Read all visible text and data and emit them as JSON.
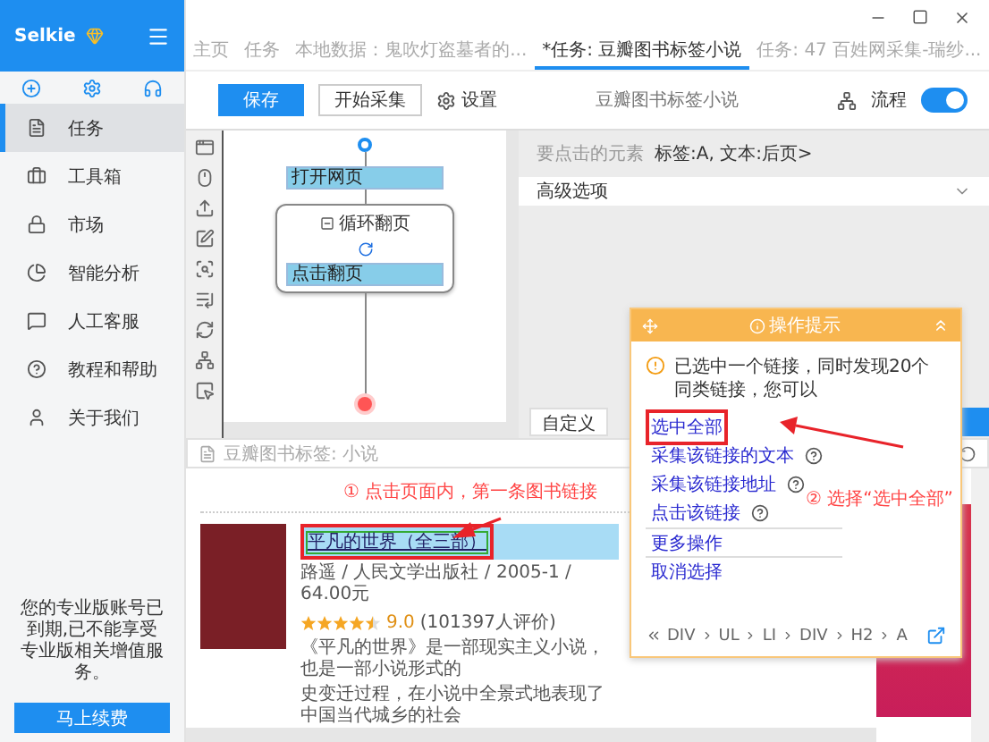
{
  "app": {
    "name": "Selkie"
  },
  "sidebar": {
    "items": [
      {
        "label": "任务",
        "selected": true
      },
      {
        "label": "工具箱",
        "selected": false
      },
      {
        "label": "市场",
        "selected": false
      },
      {
        "label": "智能分析",
        "selected": false
      },
      {
        "label": "人工客服",
        "selected": false
      },
      {
        "label": "教程和帮助",
        "selected": false
      },
      {
        "label": "关于我们",
        "selected": false
      }
    ],
    "notice": "您的专业版账号已到期,已不能享受专业版相关增值服务。",
    "renew_button": "马上续费"
  },
  "tabs": [
    {
      "label": "主页",
      "selected": false
    },
    {
      "label": "任务",
      "selected": false
    },
    {
      "label": "本地数据：鬼吹灯盗墓者的...",
      "selected": false
    },
    {
      "label": "*任务: 豆瓣图书标签小说",
      "selected": true
    },
    {
      "label": "任务: 47 百姓网采集-瑞纱...",
      "selected": false
    }
  ],
  "toolbar": {
    "save": "保存",
    "start": "开始采集",
    "settings": "设置",
    "title": "豆瓣图书标签小说",
    "flow_label": "流程",
    "flow_on": true
  },
  "flow": {
    "open_page": "打开网页",
    "loop": "循环翻页",
    "click_page": "点击翻页"
  },
  "settings_panel": {
    "element_label": "要点击的元素",
    "element_value": "标签:A, 文本:后页>",
    "advanced": "高级选项",
    "custom_button": "自定义"
  },
  "url_bar": {
    "text": "豆瓣图书标签: 小说"
  },
  "page": {
    "instruction": "① 点击页面内，第一条图书链接",
    "book": {
      "title": "平凡的世界（全三部）",
      "meta": "路遥 / 人民文学出版社 / 2005-1 / 64.00元",
      "stars": 4.5,
      "rating": "9.0",
      "votes": "(101397人评价)",
      "description": [
        "《平凡的世界》是一部现实主义小说，也是一部小说形式的",
        "史变迁过程，在小说中全景式地表现了中国当代城乡的社会"
      ]
    }
  },
  "popup": {
    "title": "操作提示",
    "message": "已选中一个链接，同时发现20个同类链接，您可以",
    "annotation": "② 选择“选中全部”",
    "options": [
      {
        "label": "选中全部",
        "kind": "action",
        "help": false,
        "highlighted": true
      },
      {
        "label": "采集该链接的文本",
        "kind": "action",
        "help": true,
        "highlighted": false
      },
      {
        "label": "采集该链接地址",
        "kind": "action",
        "help": true,
        "highlighted": false
      },
      {
        "label": "点击该链接",
        "kind": "action",
        "help": true,
        "highlighted": false
      },
      {
        "label": "更多操作",
        "kind": "extra",
        "help": false,
        "highlighted": false
      },
      {
        "label": "取消选择",
        "kind": "extra",
        "help": false,
        "highlighted": false
      }
    ],
    "breadcrumb": [
      "DIV",
      "UL",
      "LI",
      "DIV",
      "H2",
      "A"
    ]
  }
}
